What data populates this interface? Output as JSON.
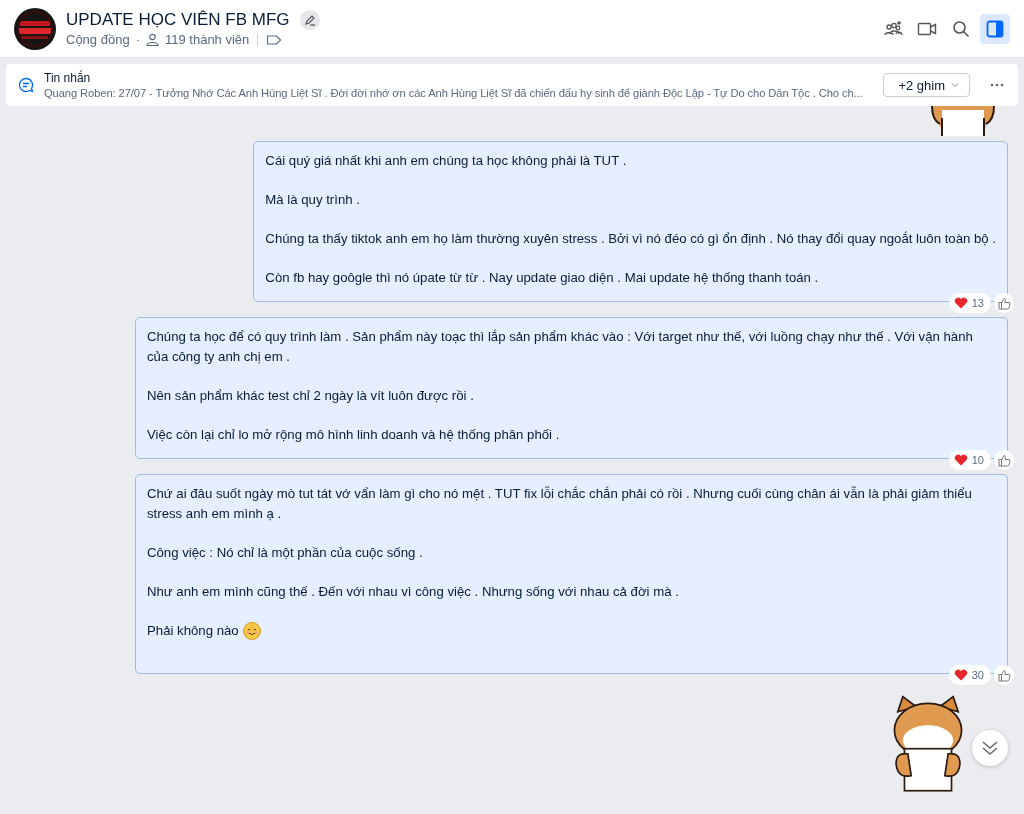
{
  "header": {
    "title": "UPDATE HỌC VIÊN FB MFG",
    "type": "Cộng đồng",
    "separator": "·",
    "members": "119 thành viên",
    "actions": [
      {
        "kind": "add-member",
        "selected": false
      },
      {
        "kind": "video",
        "selected": false
      },
      {
        "kind": "search",
        "selected": false
      },
      {
        "kind": "panel",
        "selected": true
      }
    ]
  },
  "pinned": {
    "label": "Tin nhắn",
    "text": "Quang Roben: 27/07 - Tưởng Nhớ Các Anh Hùng Liệt Sĩ . Đời đời nhớ ơn các Anh Hùng Liệt Sĩ đã chiến đấu hy sinh để giành Độc Lập - Tự Do cho Dân Tộc . Cho ch...",
    "pins_button": "+2 ghim"
  },
  "messages": [
    {
      "paragraphs": [
        "Cái quý giá nhất khi anh em chúng ta học không phải là TUT .",
        "Mà là quy trình .",
        "Chúng ta thấy tiktok anh em họ làm thường xuyên stress . Bởi vì nó đéo có gì ổn định . Nó thay đổi quay ngoắt luôn toàn bộ .",
        "Còn fb hay goôgle thì nó úpate từ từ . Nay update giao diện . Mai update hệ thống thanh toán ."
      ],
      "reactions": "13"
    },
    {
      "paragraphs": [
        "Chúng ta học để có quy trình làm . Sản phẩm này toạc thì lắp sản phẩm khác vào : Với target như thế, với luồng chạy như thế . Với vận hành của công ty anh chị em .",
        "Nên sản phẩm khác test chỉ 2 ngày là vít luôn được rồi .",
        "Việc còn lại chỉ lo mở rộng mô hình linh doanh và hệ thống phân phối ."
      ],
      "reactions": "10"
    },
    {
      "paragraphs": [
        "Chứ ai đâu suốt ngày mò tut tát vớ vẩn làm gì cho nó mệt . TUT fix lỗi chắc chắn phải có rồi . Nhưng cuối cùng chân ái vẫn là phải giảm thiểu stress anh em mình ạ .",
        "Công việc : Nó chỉ là một phần của cuộc sống .",
        "Như anh em mình cũng thế . Đến với nhau vì công việc . Nhưng sống với nhau cả đời mà .",
        "Phải không nào"
      ],
      "emoji": true,
      "reactions": "30"
    }
  ]
}
